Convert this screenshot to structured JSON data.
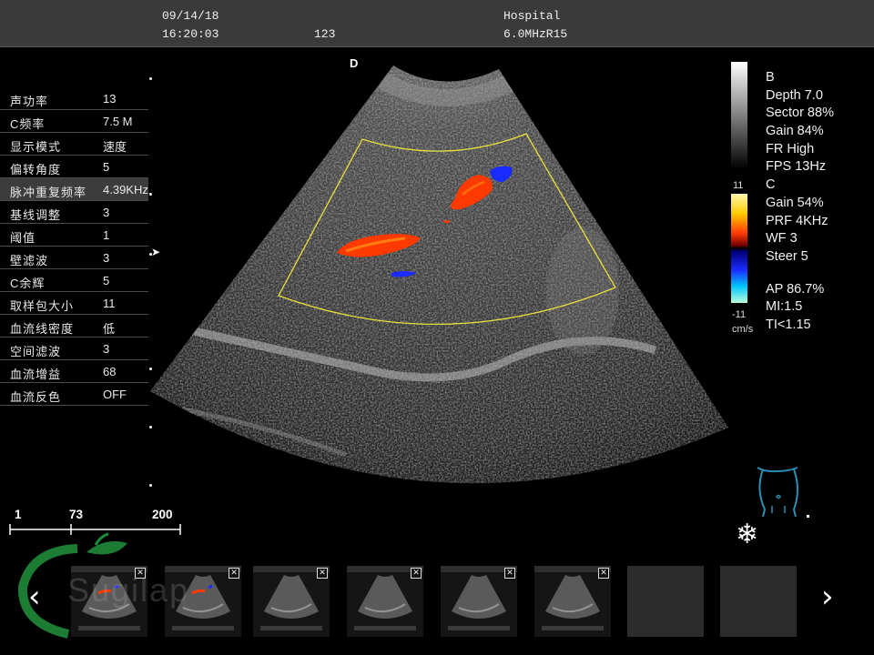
{
  "header": {
    "date": "09/14/18",
    "time": "16:20:03",
    "frame": "123",
    "hospital": "Hospital",
    "probe": "6.0MHzR15"
  },
  "image_label": "D",
  "params": [
    {
      "label": "声功率",
      "value": "13"
    },
    {
      "label": "C频率",
      "value": "7.5 M"
    },
    {
      "label": "显示模式",
      "value": "速度"
    },
    {
      "label": "偏转角度",
      "value": "5"
    },
    {
      "label": "脉冲重复频率",
      "value": "4.39KHz"
    },
    {
      "label": "基线调整",
      "value": "3"
    },
    {
      "label": "阈值",
      "value": "1"
    },
    {
      "label": "壁滤波",
      "value": "3"
    },
    {
      "label": "C余辉",
      "value": "5"
    },
    {
      "label": "取样包大小",
      "value": "11"
    },
    {
      "label": "血流线密度",
      "value": "低"
    },
    {
      "label": "空间滤波",
      "value": "3"
    },
    {
      "label": "血流增益",
      "value": "68"
    },
    {
      "label": "血流反色",
      "value": "OFF"
    }
  ],
  "selected_param_index": 4,
  "b_mode": {
    "title": "B",
    "depth": "Depth 7.0",
    "sector": "Sector 88%",
    "gain": "Gain 84%",
    "fr": "FR High",
    "fps": "FPS 13Hz"
  },
  "c_mode": {
    "title": "C",
    "gain": "Gain  54%",
    "prf": "PRF 4KHz",
    "wf": "WF 3",
    "steer": "Steer 5"
  },
  "output": {
    "ap": "AP 86.7%",
    "mi": "MI:1.5",
    "ti": "TI<1.15"
  },
  "color_scale": {
    "max": "11",
    "min": "-11",
    "unit": "cm/s"
  },
  "scale_bar": {
    "start": "1",
    "current": "73",
    "end": "200"
  },
  "watermark_text": "Sugilap",
  "thumbnail_close_glyph": "✕",
  "icons": {
    "prev": "chevron-left-icon",
    "next": "chevron-right-icon",
    "freeze": "snowflake-icon",
    "body_mark": "abdomen-bodymark-icon"
  },
  "colors": {
    "flow_red": "#ff3a00",
    "flow_blue": "#1a2bff",
    "roi": "#e8e23a"
  }
}
